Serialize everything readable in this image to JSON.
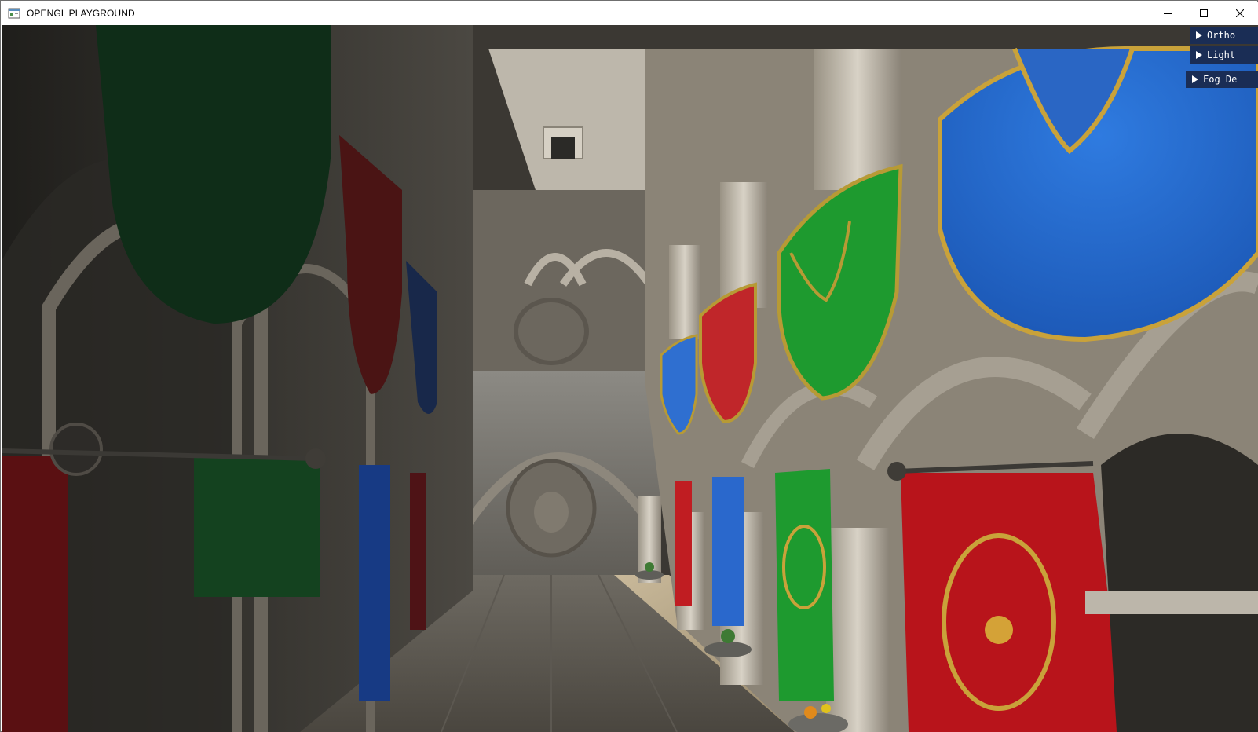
{
  "window": {
    "title": "OPENGL PLAYGROUND",
    "icon": "app-window-icon",
    "controls": [
      "minimize-icon",
      "maximize-icon",
      "close-icon"
    ]
  },
  "overlay": {
    "panels": [
      {
        "label": "Ortho"
      },
      {
        "label": "Light"
      },
      {
        "label": "Fog De"
      }
    ]
  },
  "scene": {
    "description_colors": {
      "stone": "#8a8377",
      "shadow": "#2a2824",
      "banner_green": "#1e9a2f",
      "banner_blue": "#2a6fd0",
      "banner_red": "#c01a1f",
      "gold": "#c9a23a",
      "imgui_header": "#1a2d55"
    }
  }
}
